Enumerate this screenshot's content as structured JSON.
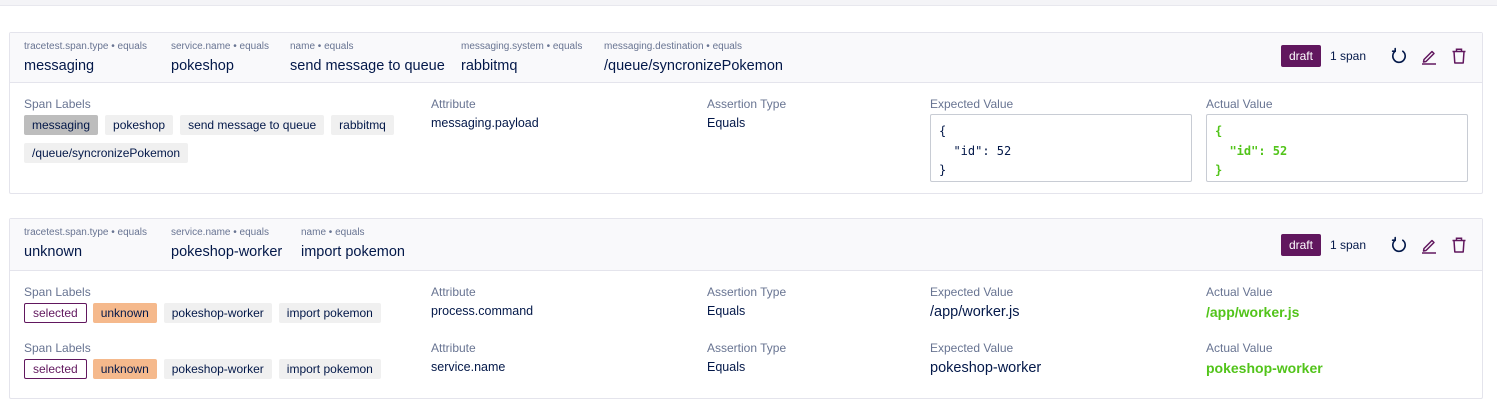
{
  "card1": {
    "selectors": [
      {
        "key": "tracetest.span.type • equals",
        "value": "messaging"
      },
      {
        "key": "service.name • equals",
        "value": "pokeshop"
      },
      {
        "key": "name • equals",
        "value": "send message to queue"
      },
      {
        "key": "messaging.system • equals",
        "value": "rabbitmq"
      },
      {
        "key": "messaging.destination • equals",
        "value": "/queue/syncronizePokemon"
      }
    ],
    "status": "draft",
    "span_count": "1 span",
    "row": {
      "span_labels_title": "Span Labels",
      "labels": [
        "messaging",
        "pokeshop",
        "send message to queue",
        "rabbitmq",
        "/queue/syncronizePokemon"
      ],
      "attribute_title": "Attribute",
      "attribute": "messaging.payload",
      "assertion_type_title": "Assertion Type",
      "assertion_type": "Equals",
      "expected_title": "Expected Value",
      "expected": "{\n  \"id\": 52\n}",
      "actual_title": "Actual Value",
      "actual": "{\n  \"id\": 52\n}"
    }
  },
  "card2": {
    "selectors": [
      {
        "key": "tracetest.span.type • equals",
        "value": "unknown"
      },
      {
        "key": "service.name • equals",
        "value": "pokeshop-worker"
      },
      {
        "key": "name • equals",
        "value": "import pokemon"
      }
    ],
    "status": "draft",
    "span_count": "1 span",
    "rows": [
      {
        "span_labels_title": "Span Labels",
        "labels": [
          "selected",
          "unknown",
          "pokeshop-worker",
          "import pokemon"
        ],
        "attribute_title": "Attribute",
        "attribute": "process.command",
        "assertion_type_title": "Assertion Type",
        "assertion_type": "Equals",
        "expected_title": "Expected Value",
        "expected": "/app/worker.js",
        "actual_title": "Actual Value",
        "actual": "/app/worker.js"
      },
      {
        "span_labels_title": "Span Labels",
        "labels": [
          "selected",
          "unknown",
          "pokeshop-worker",
          "import pokemon"
        ],
        "attribute_title": "Attribute",
        "attribute": "service.name",
        "assertion_type_title": "Assertion Type",
        "assertion_type": "Equals",
        "expected_title": "Expected Value",
        "expected": "pokeshop-worker",
        "actual_title": "Actual Value",
        "actual": "pokeshop-worker"
      }
    ]
  },
  "icons": [
    "revert-icon",
    "edit-icon",
    "delete-icon"
  ],
  "colors": {
    "draft_badge": "#61175e",
    "actual_value_pass": "#52c41a",
    "label_unknown": "#f5b98c",
    "label_selected_border": "#61175e"
  }
}
